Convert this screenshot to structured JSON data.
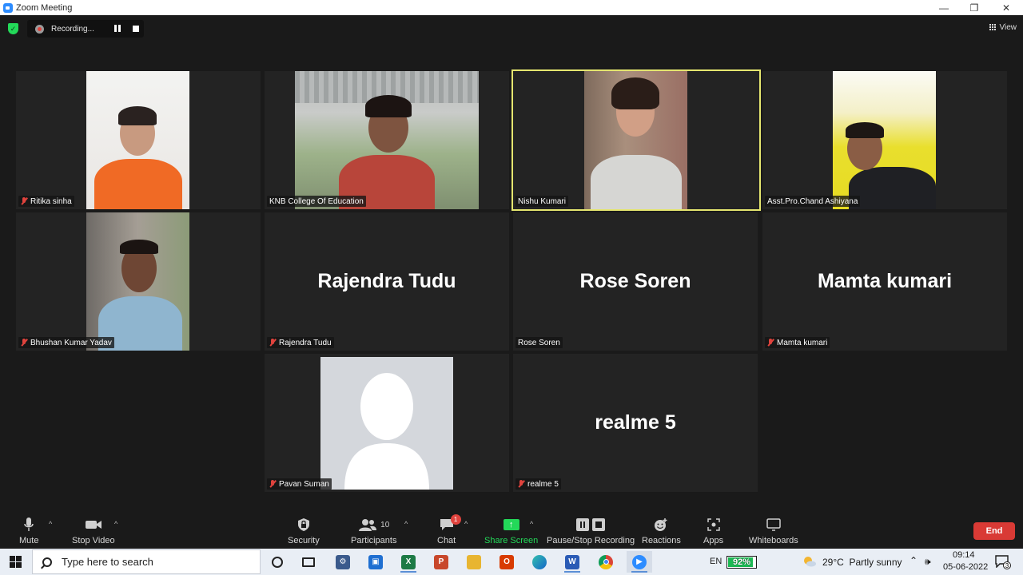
{
  "window": {
    "title": "Zoom Meeting",
    "minimize_glyph": "—",
    "restore_glyph": "❐",
    "close_glyph": "✕"
  },
  "recording": {
    "label": "Recording..."
  },
  "view": {
    "label": "View"
  },
  "participants_tiles": [
    {
      "name": "Ritika sinha",
      "muted": true,
      "video": true
    },
    {
      "name": "KNB College Of Education",
      "muted": false,
      "video": true
    },
    {
      "name": "Nishu Kumari",
      "muted": false,
      "video": true,
      "active_speaker": true
    },
    {
      "name": "Asst.Pro.Chand Ashiyana",
      "muted": false,
      "video": true
    },
    {
      "name": "Bhushan Kumar Yadav",
      "muted": true,
      "video": true
    },
    {
      "name": "Rajendra Tudu",
      "muted": true,
      "video": false,
      "display_name": "Rajendra Tudu"
    },
    {
      "name": "Rose Soren",
      "muted": false,
      "video": false,
      "display_name": "Rose Soren"
    },
    {
      "name": "Mamta kumari",
      "muted": true,
      "video": false,
      "display_name": "Mamta kumari"
    },
    {
      "name": "Pavan Suman",
      "muted": true,
      "video": false,
      "avatar": "default-silhouette"
    },
    {
      "name": "realme 5",
      "muted": true,
      "video": false,
      "display_name": "realme 5"
    }
  ],
  "toolbar": {
    "mute_label": "Mute",
    "stop_video_label": "Stop Video",
    "security_label": "Security",
    "participants_label": "Participants",
    "participants_count": "10",
    "chat_label": "Chat",
    "chat_badge": "1",
    "share_screen_label": "Share Screen",
    "share_arrow": "↑",
    "recording_label": "Pause/Stop Recording",
    "reactions_label": "Reactions",
    "apps_label": "Apps",
    "whiteboards_label": "Whiteboards",
    "end_label": "End",
    "caret": "^"
  },
  "taskbar": {
    "search_placeholder": "Type here to search",
    "language": "EN",
    "battery": "92%",
    "battery_level": 0.92,
    "weather": "29°C  Partly sunny",
    "time": "09:14",
    "date": "05-06-2022",
    "notification_count": "3"
  },
  "colors": {
    "active_speaker_border": "#e5e66f",
    "muted_red": "#e0433d",
    "share_green": "#23d959",
    "end_red": "#d93a35"
  }
}
